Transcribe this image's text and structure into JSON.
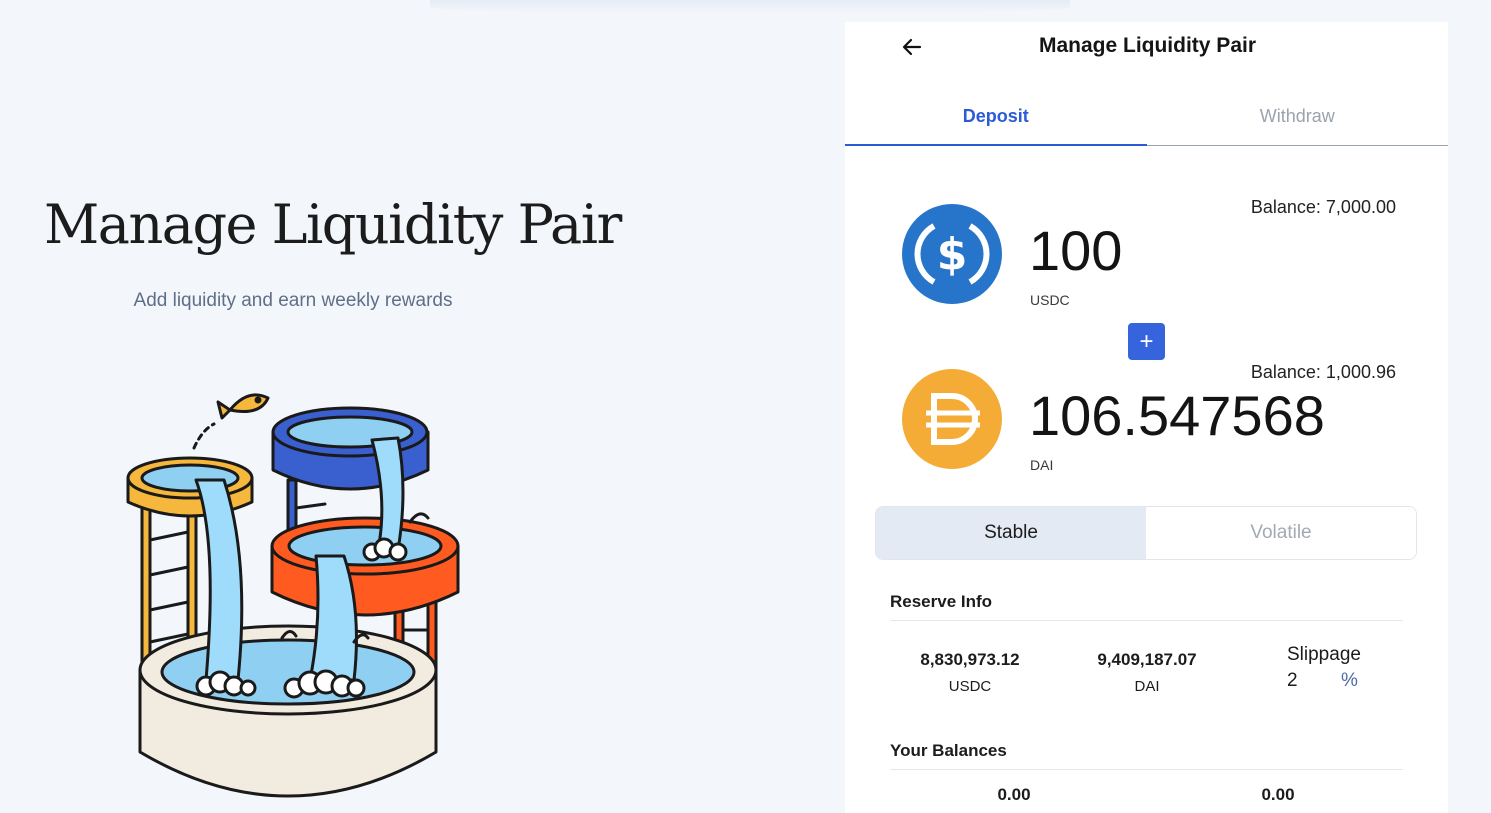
{
  "hero": {
    "title": "Manage Liquidity Pair",
    "subtitle": "Add liquidity and earn weekly rewards"
  },
  "panel": {
    "title": "Manage Liquidity Pair",
    "back_icon": "arrow-left-icon",
    "tabs": [
      {
        "label": "Deposit",
        "active": true
      },
      {
        "label": "Withdraw",
        "active": false
      }
    ]
  },
  "token_a": {
    "symbol": "USDC",
    "amount": "100",
    "balance": "Balance: 7,000.00",
    "icon": "usdc-icon",
    "color": "#2775ca"
  },
  "token_b": {
    "symbol": "DAI",
    "amount": "106.547568",
    "balance": "Balance: 1,000.96",
    "icon": "dai-icon",
    "color": "#f5ac37"
  },
  "plus_label": "+",
  "pool_type": {
    "options": [
      {
        "label": "Stable",
        "active": true
      },
      {
        "label": "Volatile",
        "active": false
      }
    ]
  },
  "reserve_info": {
    "title": "Reserve Info",
    "items": [
      {
        "value": "8,830,973.12",
        "symbol": "USDC"
      },
      {
        "value": "9,409,187.07",
        "symbol": "DAI"
      }
    ],
    "slippage_label": "Slippage",
    "slippage_value": "2",
    "slippage_unit": "%"
  },
  "your_balances": {
    "title": "Your Balances",
    "values": [
      "0.00",
      "0.00"
    ]
  },
  "colors": {
    "accent": "#3564dc",
    "tab_active": "#2d5bd8",
    "background": "#f3f7fc"
  }
}
